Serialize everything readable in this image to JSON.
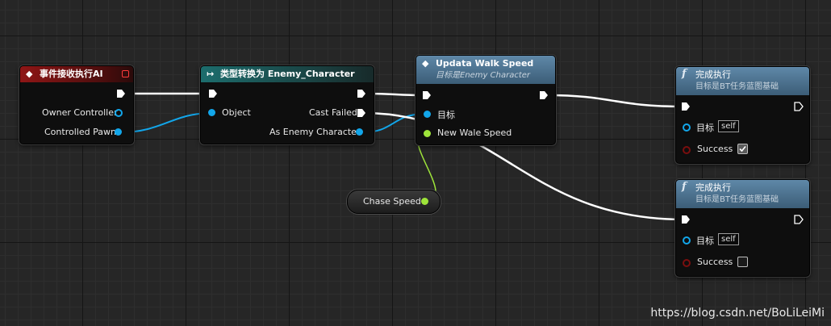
{
  "event_node": {
    "title": "事件接收执行AI",
    "pins": {
      "owner": "Owner Controller",
      "pawn": "Controlled Pawn"
    }
  },
  "cast_node": {
    "title": "类型转换为 Enemy_Character",
    "pins": {
      "object": "Object",
      "cast_failed": "Cast Failed",
      "as_enemy": "As Enemy Character"
    }
  },
  "update_node": {
    "title": "Updata Walk Speed",
    "subtitle": "目标是Enemy Character",
    "pins": {
      "target": "目标",
      "new_speed": "New Wale Speed"
    }
  },
  "finish_nodes": [
    {
      "title": "完成执行",
      "subtitle": "目标是BT任务蓝图基础",
      "target_label": "目标",
      "self_tag": "self",
      "success_label": "Success",
      "success_checked": true
    },
    {
      "title": "完成执行",
      "subtitle": "目标是BT任务蓝图基础",
      "target_label": "目标",
      "self_tag": "self",
      "success_label": "Success",
      "success_checked": false
    }
  ],
  "variable_node": {
    "label": "Chase Speed"
  },
  "watermark": "https://blog.csdn.net/BoLiLeiMi",
  "colors": {
    "exec": "#ffffff",
    "object_pin": "#12a6ea",
    "float_pin": "#9ee43a",
    "bool_pin": "#7a0e0e"
  },
  "icons": {
    "event": "event-diamond-icon",
    "cast": "cast-arrow-icon",
    "function": "function-f-icon"
  }
}
